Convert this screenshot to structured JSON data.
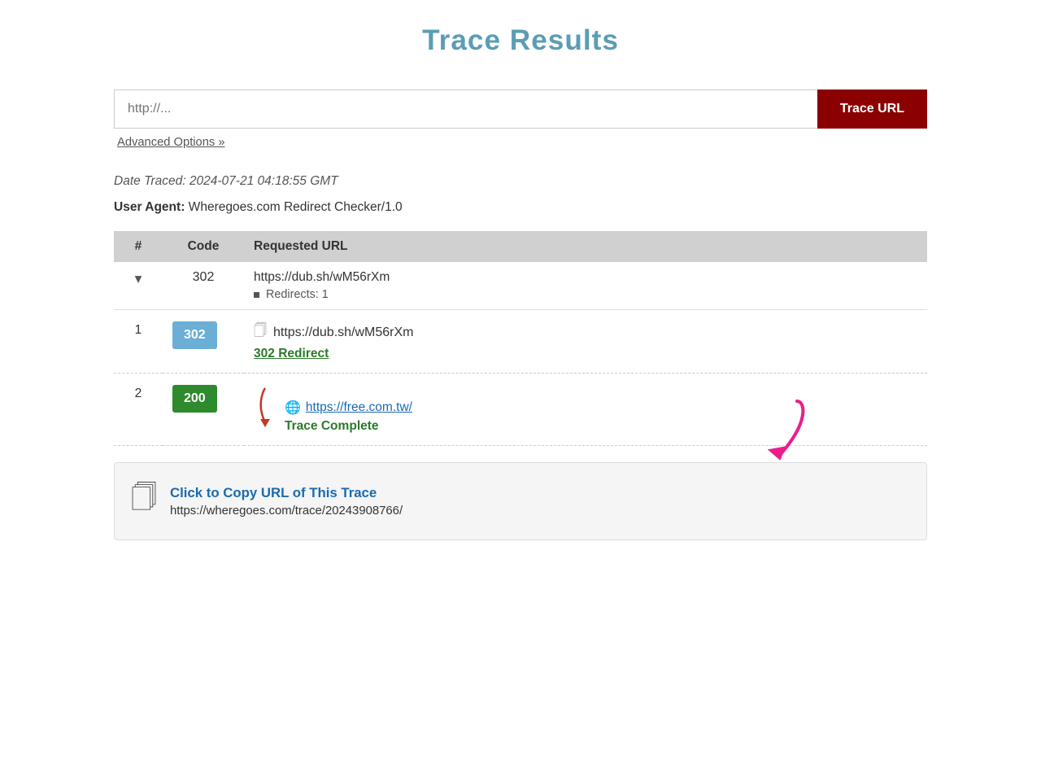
{
  "page": {
    "title": "Trace Results"
  },
  "search": {
    "placeholder": "http://...",
    "button_label": "Trace URL",
    "advanced_options_label": "Advanced Options »"
  },
  "results": {
    "date_traced_label": "Date Traced:",
    "date_traced_value": "2024-07-21 04:18:55 GMT",
    "user_agent_label": "User Agent:",
    "user_agent_value": "Wheregoes.com Redirect Checker/1.0",
    "table": {
      "col_number": "#",
      "col_code": "Code",
      "col_url": "Requested URL"
    },
    "summary": {
      "chevron": "▾",
      "code": "302",
      "url": "https://dub.sh/wM56rXm",
      "redirects_label": "Redirects: 1"
    },
    "rows": [
      {
        "number": "1",
        "code": "302",
        "code_type": "blue",
        "url": "https://dub.sh/wM56rXm",
        "status_label": "302 Redirect"
      },
      {
        "number": "2",
        "code": "200",
        "code_type": "green",
        "url": "https://free.com.tw/",
        "status_label": "Trace Complete"
      }
    ],
    "copy_section": {
      "title": "Click to Copy URL of This Trace",
      "url": "https://wheregoes.com/trace/20243908766/"
    }
  }
}
